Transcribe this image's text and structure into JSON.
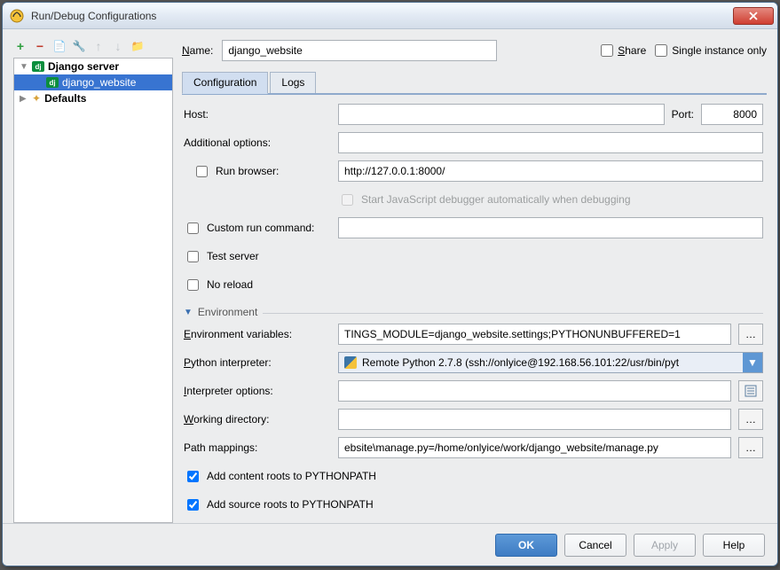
{
  "window": {
    "title": "Run/Debug Configurations"
  },
  "toolbar_icons": {
    "add": "+",
    "remove": "−",
    "copy": "📄",
    "save": "🔧",
    "up": "↑",
    "down": "↓",
    "folder": "📁"
  },
  "tree": {
    "django_server": "Django server",
    "django_website": "django_website",
    "defaults": "Defaults"
  },
  "top": {
    "name_label": "Name:",
    "name_value": "django_website",
    "share_label": "Share",
    "single_instance_label": "Single instance only",
    "share_checked": false,
    "single_instance_checked": false
  },
  "tabs": {
    "configuration": "Configuration",
    "logs": "Logs"
  },
  "form": {
    "host_label": "Host:",
    "host_value": "",
    "port_label": "Port:",
    "port_value": "8000",
    "additional_options_label": "Additional options:",
    "additional_options_value": "",
    "run_browser_label": "Run browser:",
    "run_browser_checked": false,
    "run_browser_value": "http://127.0.0.1:8000/",
    "js_debugger_label": "Start JavaScript debugger automatically when debugging",
    "js_debugger_checked": false,
    "custom_run_label": "Custom run command:",
    "custom_run_checked": false,
    "custom_run_value": "",
    "test_server_label": "Test server",
    "test_server_checked": false,
    "no_reload_label": "No reload",
    "no_reload_checked": false,
    "env_section": "Environment",
    "env_vars_label": "Environment variables:",
    "env_vars_value": "TINGS_MODULE=django_website.settings;PYTHONUNBUFFERED=1",
    "python_interp_label": "Python interpreter:",
    "python_interp_value": "Remote Python 2.7.8 (ssh://onlyice@192.168.56.101:22/usr/bin/pyt",
    "interp_options_label": "Interpreter options:",
    "interp_options_value": "",
    "working_dir_label": "Working directory:",
    "working_dir_value": "",
    "path_mappings_label": "Path mappings:",
    "path_mappings_value": "ebsite\\manage.py=/home/onlyice/work/django_website/manage.py",
    "add_content_roots_label": "Add content roots to PYTHONPATH",
    "add_content_roots_checked": true,
    "add_source_roots_label": "Add source roots to PYTHONPATH",
    "add_source_roots_checked": true
  },
  "buttons": {
    "ok": "OK",
    "cancel": "Cancel",
    "apply": "Apply",
    "help": "Help"
  }
}
